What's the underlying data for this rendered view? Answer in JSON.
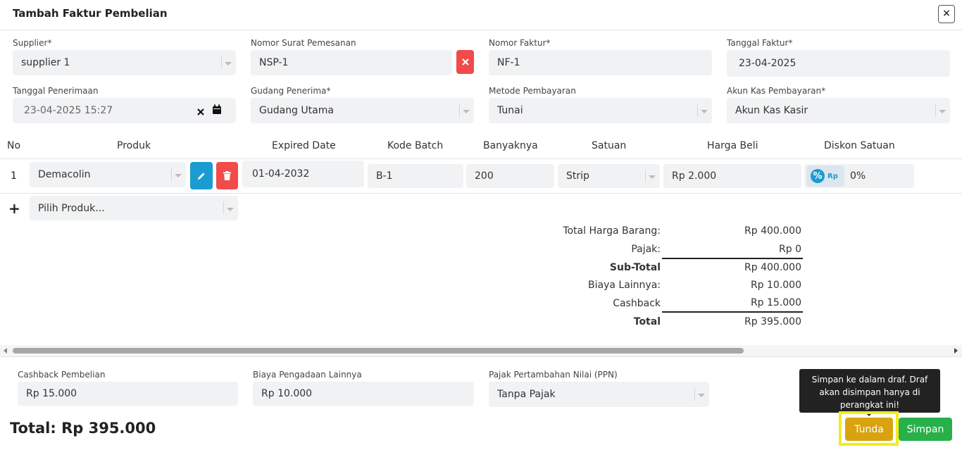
{
  "header": {
    "title": "Tambah Faktur Pembelian",
    "close_label": "×"
  },
  "form": {
    "supplier": {
      "label": "Supplier*",
      "value": "supplier 1"
    },
    "nomor_surat": {
      "label": "Nomor Surat Pemesanan",
      "value": "NSP-1"
    },
    "nomor_faktur": {
      "label": "Nomor Faktur*",
      "value": "NF-1"
    },
    "tanggal_faktur": {
      "label": "Tanggal Faktur*",
      "value": "23-04-2025"
    },
    "tanggal_penerimaan": {
      "label": "Tanggal Penerimaan",
      "value": "23-04-2025 15:27"
    },
    "gudang": {
      "label": "Gudang Penerima*",
      "value": "Gudang Utama"
    },
    "metode": {
      "label": "Metode Pembayaran",
      "value": "Tunai"
    },
    "akun_kas": {
      "label": "Akun Kas Pembayaran*",
      "value": "Akun Kas Kasir"
    }
  },
  "table": {
    "headers": [
      "No",
      "Produk",
      "Expired Date",
      "Kode Batch",
      "Banyaknya",
      "Satuan",
      "Harga Beli",
      "Diskon Satuan"
    ],
    "row": {
      "no": "1",
      "produk": "Demacolin",
      "expired": "01-04-2032",
      "batch": "B-1",
      "qty": "200",
      "satuan": "Strip",
      "harga": "Rp 2.000",
      "diskon_toggle": "Rp",
      "diskon": "0%"
    },
    "add_symbol": "+",
    "add_placeholder": "Pilih Produk..."
  },
  "summary": {
    "total_harga_label": "Total Harga Barang:",
    "total_harga": "Rp 400.000",
    "pajak_label": "Pajak:",
    "pajak": "Rp 0",
    "subtotal_label": "Sub-Total",
    "subtotal": "Rp 400.000",
    "biaya_label": "Biaya Lainnya:",
    "biaya": "Rp 10.000",
    "cashback_label": "Cashback",
    "cashback": "Rp 15.000",
    "total_label": "Total",
    "total": "Rp 395.000"
  },
  "footer": {
    "cashback": {
      "label": "Cashback Pembelian",
      "value": "Rp 15.000"
    },
    "biaya": {
      "label": "Biaya Pengadaan Lainnya",
      "value": "Rp 10.000"
    },
    "ppn": {
      "label": "Pajak Pertambahan Nilai (PPN)",
      "value": "Tanpa Pajak"
    },
    "grand_total": "Total: Rp 395.000",
    "tooltip": "Simpan ke dalam draf. Draf akan disimpan hanya di perangkat ini!",
    "tunda_label": "Tunda",
    "simpan_label": "Simpan"
  },
  "colors": {
    "danger": "#f24b4b",
    "info": "#1a9bd1",
    "warning": "#d9a30f",
    "success": "#28b04a",
    "highlight": "#f3ec1a"
  }
}
